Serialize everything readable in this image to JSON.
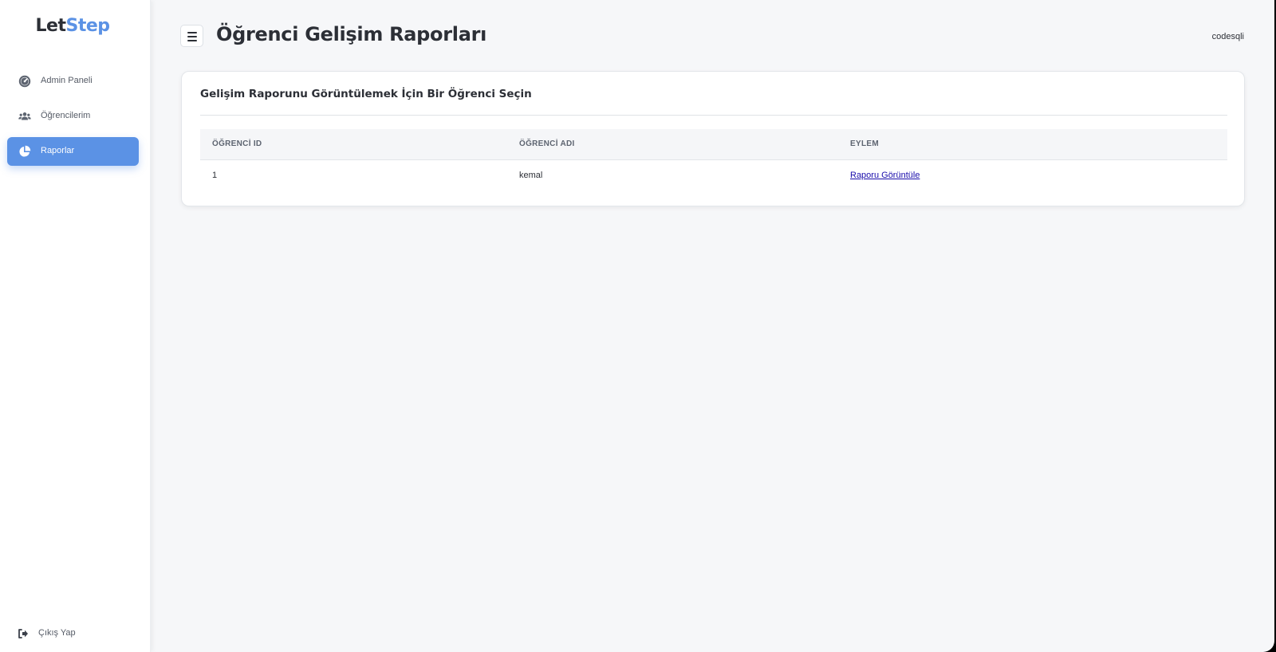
{
  "brand": {
    "part1": "Let",
    "part2": "Step",
    "part2_color": "#5b92e5"
  },
  "sidebar": {
    "items": [
      {
        "label": "Admin Paneli",
        "icon": "gauge-icon",
        "active": false
      },
      {
        "label": "Öğrencilerim",
        "icon": "users-icon",
        "active": false
      },
      {
        "label": "Raporlar",
        "icon": "pie-chart-icon",
        "active": true
      }
    ],
    "logout": {
      "label": "Çıkış Yap",
      "icon": "sign-out-icon"
    }
  },
  "header": {
    "menu_icon": "hamburger-icon",
    "title": "Öğrenci Gelişim Raporları",
    "user": "codesqli"
  },
  "card": {
    "title": "Gelişim Raporunu Görüntülemek İçin Bir Öğrenci Seçin",
    "table": {
      "columns": [
        "ÖĞRENCİ ID",
        "ÖĞRENCİ ADI",
        "EYLEM"
      ],
      "rows": [
        {
          "id": "1",
          "name": "kemal",
          "action": "Raporu Görüntüle"
        }
      ]
    }
  },
  "colors": {
    "accent": "#5b92e5",
    "background": "#f6f7f9",
    "text": "#2c2f36",
    "link": "#1a0dab"
  }
}
